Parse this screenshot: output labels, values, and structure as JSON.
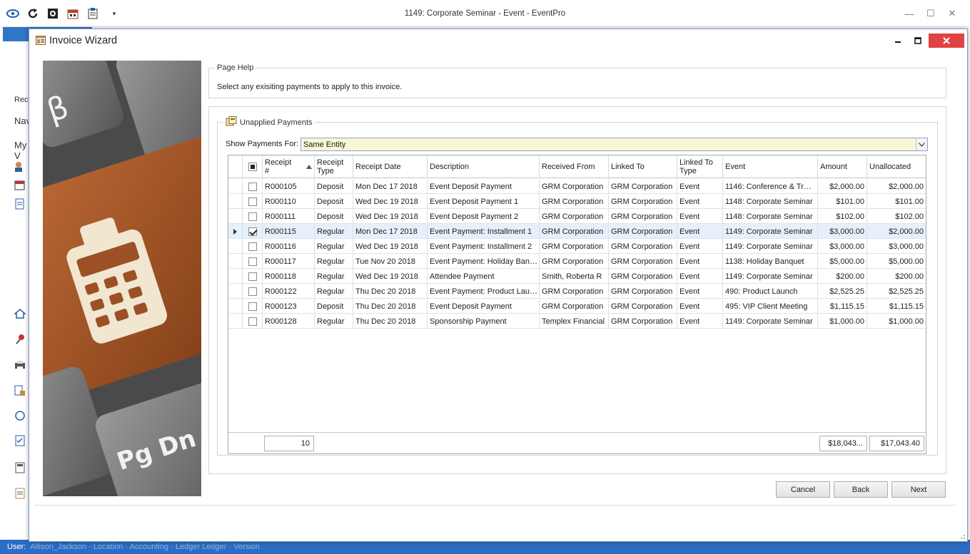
{
  "app": {
    "title": "1149: Corporate Seminar - Event - EventPro",
    "left_fragments": [
      "Rec",
      "Nav",
      "My V"
    ],
    "status_user": "User:",
    "status_rest": "Allison_Jackson · Location · Accounting · Ledger Ledger · Version"
  },
  "dialog": {
    "title": "Invoice Wizard"
  },
  "page_help": {
    "legend": "Page Help",
    "text": "Select any exisiting payments to apply to this invoice."
  },
  "unapplied": {
    "legend": "Unapplied Payments",
    "show_label": "Show Payments For:",
    "show_value": "Same Entity"
  },
  "grid": {
    "columns": [
      {
        "key": "receipt",
        "label_1": "Receipt",
        "label_2": "#"
      },
      {
        "key": "type",
        "label_1": "Receipt",
        "label_2": "Type"
      },
      {
        "key": "date",
        "label_1": "Receipt Date",
        "label_2": ""
      },
      {
        "key": "desc",
        "label_1": "Description",
        "label_2": ""
      },
      {
        "key": "from",
        "label_1": "Received From",
        "label_2": ""
      },
      {
        "key": "linked",
        "label_1": "Linked To",
        "label_2": ""
      },
      {
        "key": "ltype",
        "label_1": "Linked To",
        "label_2": "Type"
      },
      {
        "key": "event",
        "label_1": "Event",
        "label_2": ""
      },
      {
        "key": "amount",
        "label_1": "Amount",
        "label_2": ""
      },
      {
        "key": "unalloc",
        "label_1": "Unallocated",
        "label_2": ""
      }
    ],
    "rows": [
      {
        "checked": false,
        "receipt": "R000105",
        "type": "Deposit",
        "date": "Mon Dec 17 2018",
        "desc": "Event Deposit Payment",
        "from": "GRM Corporation",
        "linked": "GRM Corporation",
        "ltype": "Event",
        "event": "1146: Conference & Tr…",
        "amount": "$2,000.00",
        "unalloc": "$2,000.00"
      },
      {
        "checked": false,
        "receipt": "R000110",
        "type": "Deposit",
        "date": "Wed Dec 19 2018",
        "desc": "Event Deposit Payment 1",
        "from": "GRM Corporation",
        "linked": "GRM Corporation",
        "ltype": "Event",
        "event": "1148: Corporate Seminar",
        "amount": "$101.00",
        "unalloc": "$101.00"
      },
      {
        "checked": false,
        "receipt": "R000111",
        "type": "Deposit",
        "date": "Wed Dec 19 2018",
        "desc": "Event Deposit Payment 2",
        "from": "GRM Corporation",
        "linked": "GRM Corporation",
        "ltype": "Event",
        "event": "1148: Corporate Seminar",
        "amount": "$102.00",
        "unalloc": "$102.00"
      },
      {
        "checked": true,
        "receipt": "R000115",
        "type": "Regular",
        "date": "Mon Dec 17 2018",
        "desc": "Event Payment: Installment 1",
        "from": "GRM Corporation",
        "linked": "GRM Corporation",
        "ltype": "Event",
        "event": "1149: Corporate Seminar",
        "amount": "$3,000.00",
        "unalloc": "$2,000.00"
      },
      {
        "checked": false,
        "receipt": "R000116",
        "type": "Regular",
        "date": "Wed Dec 19 2018",
        "desc": "Event Payment: Installment 2",
        "from": "GRM Corporation",
        "linked": "GRM Corporation",
        "ltype": "Event",
        "event": "1149: Corporate Seminar",
        "amount": "$3,000.00",
        "unalloc": "$3,000.00"
      },
      {
        "checked": false,
        "receipt": "R000117",
        "type": "Regular",
        "date": "Tue Nov 20 2018",
        "desc": "Event Payment: Holiday Ban…",
        "from": "GRM Corporation",
        "linked": "GRM Corporation",
        "ltype": "Event",
        "event": "1138: Holiday Banquet",
        "amount": "$5,000.00",
        "unalloc": "$5,000.00"
      },
      {
        "checked": false,
        "receipt": "R000118",
        "type": "Regular",
        "date": "Wed Dec 19 2018",
        "desc": "Attendee Payment",
        "from": "Smith, Roberta R",
        "linked": "GRM Corporation",
        "ltype": "Event",
        "event": "1149: Corporate Seminar",
        "amount": "$200.00",
        "unalloc": "$200.00"
      },
      {
        "checked": false,
        "receipt": "R000122",
        "type": "Regular",
        "date": "Thu Dec 20 2018",
        "desc": "Event Payment: Product Lau…",
        "from": "GRM Corporation",
        "linked": "GRM Corporation",
        "ltype": "Event",
        "event": "490: Product Launch",
        "amount": "$2,525.25",
        "unalloc": "$2,525.25"
      },
      {
        "checked": false,
        "receipt": "R000123",
        "type": "Deposit",
        "date": "Thu Dec 20 2018",
        "desc": "Event Deposit Payment",
        "from": "GRM Corporation",
        "linked": "GRM Corporation",
        "ltype": "Event",
        "event": "495: VIP Client Meeting",
        "amount": "$1,115.15",
        "unalloc": "$1,115.15"
      },
      {
        "checked": false,
        "receipt": "R000128",
        "type": "Regular",
        "date": "Thu Dec 20 2018",
        "desc": "Sponsorship Payment",
        "from": "Templex Financial",
        "linked": "GRM Corporation",
        "ltype": "Event",
        "event": "1149: Corporate Seminar",
        "amount": "$1,000.00",
        "unalloc": "$1,000.00"
      }
    ],
    "footer": {
      "count": "10",
      "amount_total": "$18,043...",
      "unallocated_total": "$17,043.40"
    }
  },
  "buttons": {
    "cancel": "Cancel",
    "back": "Back",
    "next": "Next"
  },
  "colors": {
    "selected_row": "#e6f0fb",
    "combo_bg": "#f9f7d3",
    "close_button": "#e04343",
    "status_bar": "#2b6cc4"
  },
  "icons": [
    "refresh-icon",
    "settings-icon",
    "calendar-icon",
    "clipboard-icon",
    "wizard-icon",
    "payments-icon",
    "calculator-key-image"
  ]
}
